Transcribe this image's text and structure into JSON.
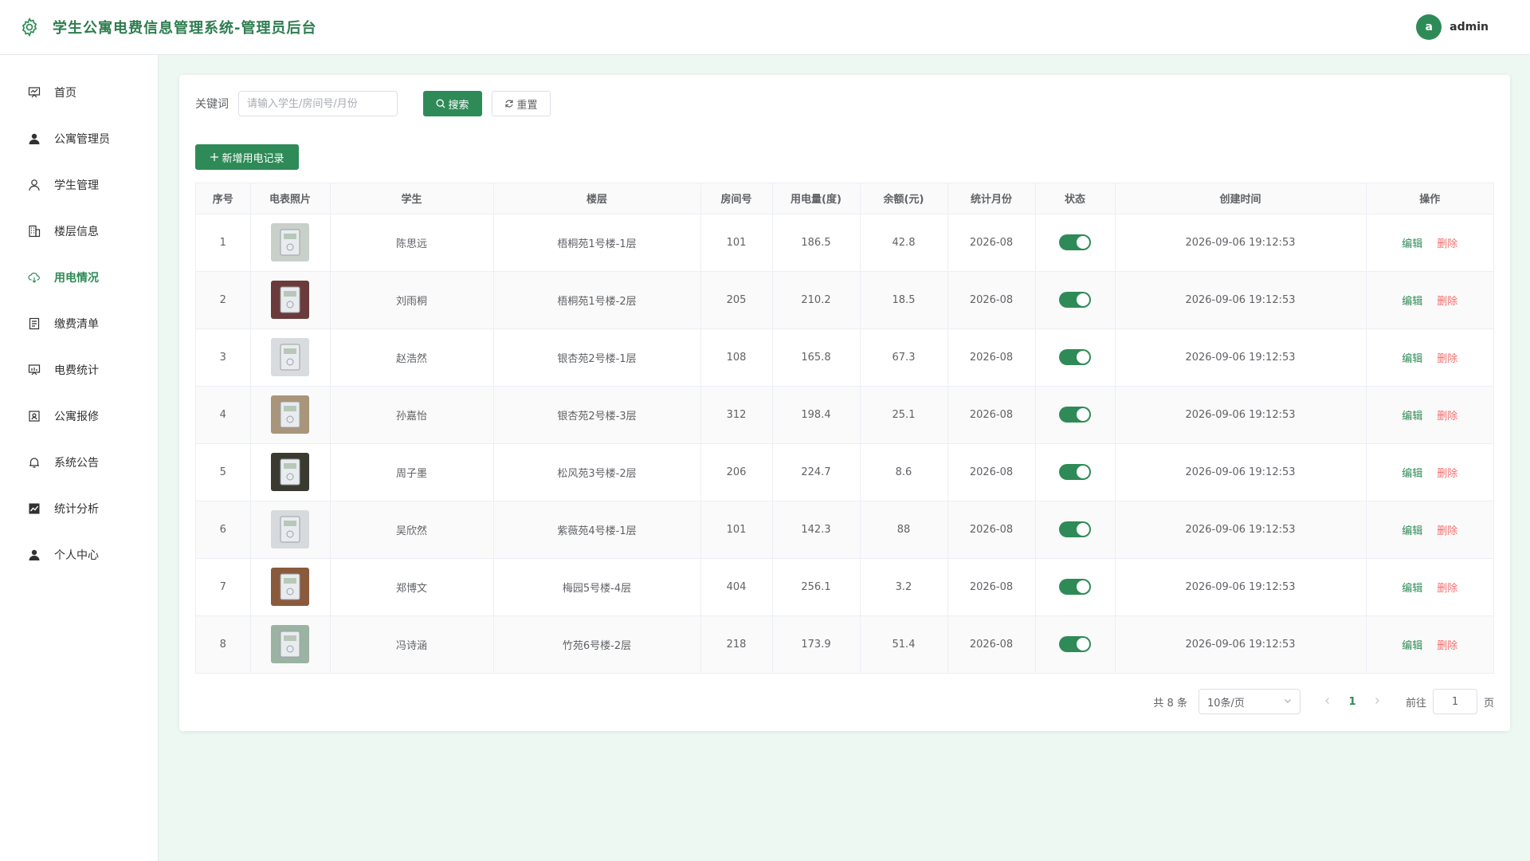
{
  "header": {
    "title": "学生公寓电费信息管理系统-管理员后台",
    "avatar_letter": "a",
    "username": "admin"
  },
  "sidebar": {
    "items": [
      {
        "label": "首页",
        "icon": "home-board-icon"
      },
      {
        "label": "公寓管理员",
        "icon": "user-filled-icon"
      },
      {
        "label": "学生管理",
        "icon": "user-outline-icon"
      },
      {
        "label": "楼层信息",
        "icon": "building-icon"
      },
      {
        "label": "用电情况",
        "icon": "cloud-electric-icon",
        "active": true
      },
      {
        "label": "缴费清单",
        "icon": "document-icon"
      },
      {
        "label": "电费统计",
        "icon": "board-chart-icon"
      },
      {
        "label": "公寓报修",
        "icon": "repair-icon"
      },
      {
        "label": "系统公告",
        "icon": "bell-icon"
      },
      {
        "label": "统计分析",
        "icon": "trend-icon"
      },
      {
        "label": "个人中心",
        "icon": "user-filled-icon"
      }
    ]
  },
  "search": {
    "label": "关键词",
    "placeholder": "请输入学生/房间号/月份",
    "search_label": "搜索",
    "reset_label": "重置"
  },
  "toolbar": {
    "add_label": "新增用电记录"
  },
  "table": {
    "columns": [
      "序号",
      "电表照片",
      "学生",
      "楼层",
      "房间号",
      "用电量(度)",
      "余额(元)",
      "统计月份",
      "状态",
      "创建时间",
      "操作"
    ],
    "edit_label": "编辑",
    "delete_label": "删除",
    "rows": [
      {
        "no": "1",
        "student": "陈思远",
        "floor": "梧桐苑1号楼-1层",
        "room": "101",
        "usage": "186.5",
        "balance": "42.8",
        "month": "2026-08",
        "status": true,
        "created": "2026-09-06 19:12:53",
        "photo_color": "#c9cfc9"
      },
      {
        "no": "2",
        "student": "刘雨桐",
        "floor": "梧桐苑1号楼-2层",
        "room": "205",
        "usage": "210.2",
        "balance": "18.5",
        "month": "2026-08",
        "status": true,
        "created": "2026-09-06 19:12:53",
        "photo_color": "#6b3b3b"
      },
      {
        "no": "3",
        "student": "赵浩然",
        "floor": "银杏苑2号楼-1层",
        "room": "108",
        "usage": "165.8",
        "balance": "67.3",
        "month": "2026-08",
        "status": true,
        "created": "2026-09-06 19:12:53",
        "photo_color": "#d9dcde"
      },
      {
        "no": "4",
        "student": "孙嘉怡",
        "floor": "银杏苑2号楼-3层",
        "room": "312",
        "usage": "198.4",
        "balance": "25.1",
        "month": "2026-08",
        "status": true,
        "created": "2026-09-06 19:12:53",
        "photo_color": "#a8957a"
      },
      {
        "no": "5",
        "student": "周子墨",
        "floor": "松风苑3号楼-2层",
        "room": "206",
        "usage": "224.7",
        "balance": "8.6",
        "month": "2026-08",
        "status": true,
        "created": "2026-09-06 19:12:53",
        "photo_color": "#3a3a30"
      },
      {
        "no": "6",
        "student": "吴欣然",
        "floor": "紫薇苑4号楼-1层",
        "room": "101",
        "usage": "142.3",
        "balance": "88",
        "month": "2026-08",
        "status": true,
        "created": "2026-09-06 19:12:53",
        "photo_color": "#d7dadd"
      },
      {
        "no": "7",
        "student": "郑博文",
        "floor": "梅园5号楼-4层",
        "room": "404",
        "usage": "256.1",
        "balance": "3.2",
        "month": "2026-08",
        "status": true,
        "created": "2026-09-06 19:12:53",
        "photo_color": "#8a5a3c"
      },
      {
        "no": "8",
        "student": "冯诗涵",
        "floor": "竹苑6号楼-2层",
        "room": "218",
        "usage": "173.9",
        "balance": "51.4",
        "month": "2026-08",
        "status": true,
        "created": "2026-09-06 19:12:53",
        "photo_color": "#9bb3a2"
      }
    ]
  },
  "pagination": {
    "total": "共 8 条",
    "page_size": "10条/页",
    "current_page": "1",
    "goto_label": "前往",
    "goto_value": "1",
    "page_unit": "页"
  },
  "colors": {
    "primary": "#2e8b57",
    "danger": "#f56c6c",
    "background": "#eef8f2"
  }
}
